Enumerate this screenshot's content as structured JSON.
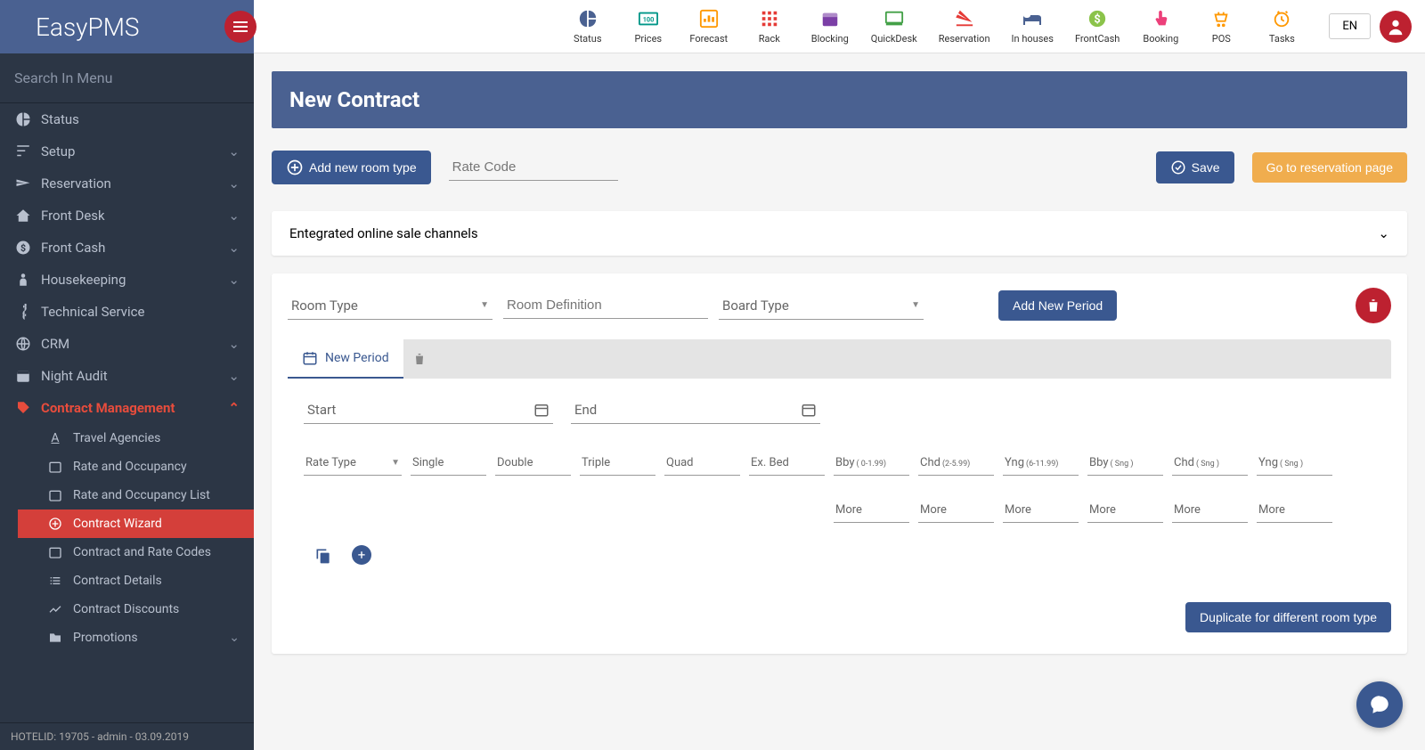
{
  "app": {
    "logo": "EasyPMS"
  },
  "searchMenu": {
    "placeholder": "Search In Menu"
  },
  "sidebar": {
    "items": [
      {
        "label": "Status",
        "icon": "pie"
      },
      {
        "label": "Setup",
        "icon": "sliders",
        "expandable": true
      },
      {
        "label": "Reservation",
        "icon": "plane",
        "expandable": true
      },
      {
        "label": "Front Desk",
        "icon": "home",
        "expandable": true
      },
      {
        "label": "Front Cash",
        "icon": "dollar",
        "expandable": true
      },
      {
        "label": "Housekeeping",
        "icon": "person",
        "expandable": true
      },
      {
        "label": "Technical Service",
        "icon": "wrench"
      },
      {
        "label": "CRM",
        "icon": "globe",
        "expandable": true
      },
      {
        "label": "Night Audit",
        "icon": "calendar",
        "expandable": true
      },
      {
        "label": "Contract Management",
        "icon": "tag",
        "expandable": true,
        "expanded": true,
        "children": [
          {
            "label": "Travel Agencies",
            "icon": "a"
          },
          {
            "label": "Rate and Occupancy",
            "icon": "cal"
          },
          {
            "label": "Rate and Occupancy List",
            "icon": "cal"
          },
          {
            "label": "Contract Wizard",
            "icon": "plus",
            "active": true
          },
          {
            "label": "Contract and Rate Codes",
            "icon": "cal"
          },
          {
            "label": "Contract Details",
            "icon": "list"
          },
          {
            "label": "Contract Discounts",
            "icon": "trend"
          },
          {
            "label": "Promotions",
            "icon": "folder",
            "expandable": true
          }
        ]
      }
    ]
  },
  "footer": "HOTELID: 19705 - admin - 03.09.2019",
  "topnav": [
    {
      "label": "Status",
      "color": "#4a6191"
    },
    {
      "label": "Prices",
      "color": "#009688"
    },
    {
      "label": "Forecast",
      "color": "#ff9800"
    },
    {
      "label": "Rack",
      "color": "#e53935"
    },
    {
      "label": "Blocking",
      "color": "#7b3fa6"
    },
    {
      "label": "QuickDesk",
      "color": "#43a047"
    },
    {
      "label": "Reservation",
      "color": "#e53935"
    },
    {
      "label": "In houses",
      "color": "#4a6191"
    },
    {
      "label": "FrontCash",
      "color": "#8bc34a"
    },
    {
      "label": "Booking",
      "color": "#ec407a"
    },
    {
      "label": "POS",
      "color": "#ff9800"
    },
    {
      "label": "Tasks",
      "color": "#ff9800"
    }
  ],
  "lang": "EN",
  "page": {
    "title": "New Contract",
    "addRoomType": "Add new room type",
    "rateCode": "Rate Code",
    "save": "Save",
    "gotoReservation": "Go to reservation page",
    "channels": "Entegrated online sale channels",
    "roomType": "Room Type",
    "roomDefinition": "Room Definition",
    "boardType": "Board Type",
    "addNewPeriod": "Add New Period",
    "newPeriod": "New Period",
    "start": "Start",
    "end": "End",
    "rateType": "Rate Type",
    "cols": [
      "Single",
      "Double",
      "Triple",
      "Quad",
      "Ex. Bed"
    ],
    "ageSeg": [
      {
        "pre": "Bby",
        "sup": "( 0-1.99)"
      },
      {
        "pre": "Chd",
        "sup": "(2-5.99)"
      },
      {
        "pre": "Yng",
        "sup": "(6-11.99)"
      },
      {
        "pre": "Bby",
        "sup": "( Sng )"
      },
      {
        "pre": "Chd",
        "sup": "( Sng )"
      },
      {
        "pre": "Yng",
        "sup": "( Sng )"
      }
    ],
    "more": "More",
    "duplicate": "Duplicate for different room type"
  }
}
